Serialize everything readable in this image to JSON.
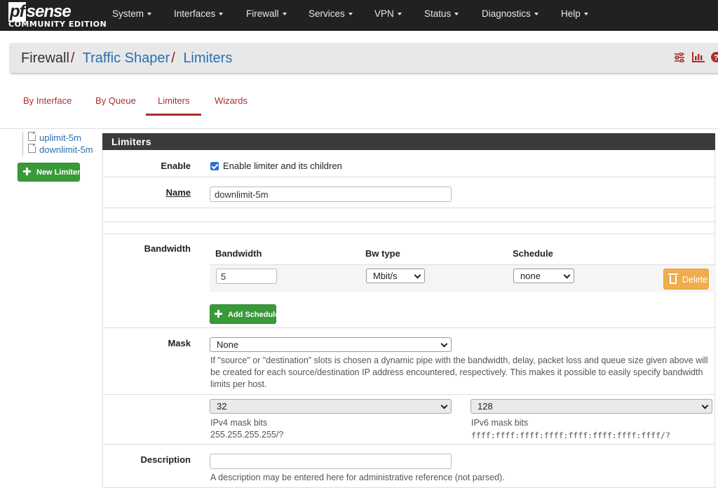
{
  "brand": {
    "logo_pf": "pf",
    "logo_sense": "sense",
    "edition": "COMMUNITY EDITION"
  },
  "nav": {
    "items": [
      {
        "label": "System"
      },
      {
        "label": "Interfaces"
      },
      {
        "label": "Firewall"
      },
      {
        "label": "Services"
      },
      {
        "label": "VPN"
      },
      {
        "label": "Status"
      },
      {
        "label": "Diagnostics"
      },
      {
        "label": "Help"
      }
    ]
  },
  "breadcrumb": {
    "root": "Firewall",
    "level1": "Traffic Shaper",
    "level2": "Limiters",
    "separator": "/"
  },
  "header_icons": [
    "sliders-icon",
    "bar-chart-icon",
    "help-icon"
  ],
  "tabs": [
    {
      "label": "By Interface",
      "active": false
    },
    {
      "label": "By Queue",
      "active": false
    },
    {
      "label": "Limiters",
      "active": true
    },
    {
      "label": "Wizards",
      "active": false
    }
  ],
  "tree": {
    "items": [
      {
        "label": "uplimit-5m"
      },
      {
        "label": "downlimit-5m"
      }
    ]
  },
  "new_limiter_label": "New Limiter",
  "panel": {
    "title": "Limiters",
    "enable": {
      "label": "Enable",
      "checkbox_label": "Enable limiter and its children",
      "checked": true
    },
    "name": {
      "label": "Name",
      "value": "downlimit-5m"
    },
    "bandwidth": {
      "label": "Bandwidth",
      "col_bandwidth": "Bandwidth",
      "col_bwtype": "Bw type",
      "col_schedule": "Schedule",
      "value": "5",
      "bwtype": "Mbit/s",
      "schedule": "none",
      "delete_label": "Delete",
      "add_schedule_label": "Add Schedule"
    },
    "mask": {
      "label": "Mask",
      "value": "None",
      "help": "If \"source\" or \"destination\" slots is chosen a dynamic pipe with the bandwidth, delay, packet loss and queue size given above will be created for each source/destination IP address encountered, respectively. This makes it possible to easily specify bandwidth limits per host.",
      "ipv4_bits": "32",
      "ipv4_label": "IPv4 mask bits",
      "ipv4_example": "255.255.255.255/?",
      "ipv6_bits": "128",
      "ipv6_label": "IPv6 mask bits",
      "ipv6_example": "ffff:ffff:ffff:ffff:ffff:ffff:ffff:ffff/?"
    },
    "description": {
      "label": "Description",
      "value": "",
      "help": "A description may be entered here for administrative reference (not parsed)."
    }
  },
  "colors": {
    "navbar": "#212121",
    "accent_red": "#a9302e",
    "link_blue": "#2a6fb0",
    "success": "#3a9a3a",
    "warning": "#f0ad4e"
  }
}
